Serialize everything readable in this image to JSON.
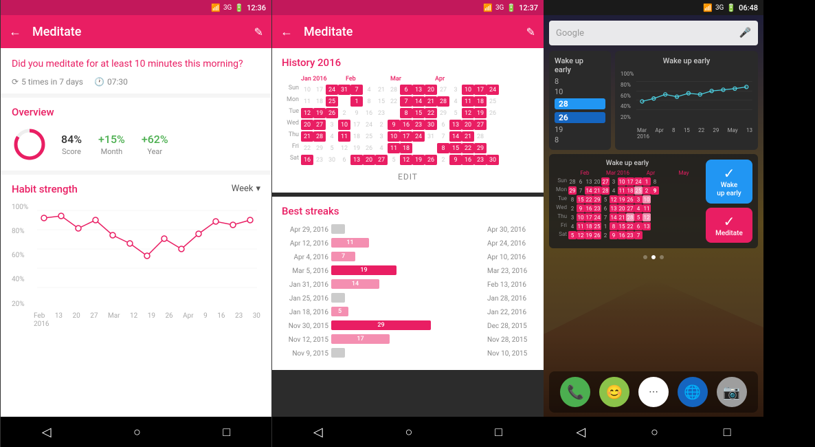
{
  "panel1": {
    "statusBar": {
      "time": "12:36",
      "icons": "📶 3G 🔋"
    },
    "appBar": {
      "title": "Meditate",
      "backLabel": "←",
      "editLabel": "✎"
    },
    "question": {
      "text": "Did you meditate for at least 10 minutes this morning?",
      "frequency": "5 times in 7 days",
      "time": "07:30"
    },
    "overview": {
      "title": "Overview",
      "score": "84%",
      "scoreLabel": "Score",
      "month": "+15%",
      "monthLabel": "Month",
      "year": "+62%",
      "yearLabel": "Year"
    },
    "habitStrength": {
      "title": "Habit strength",
      "selector": "Week",
      "yLabels": [
        "100%",
        "80%",
        "60%",
        "40%",
        "20%"
      ],
      "xLabels": [
        "Feb",
        "13",
        "20",
        "27",
        "Mar",
        "12",
        "19",
        "26",
        "Apr",
        "9",
        "16",
        "23",
        "30"
      ],
      "x2Labels": [
        "2016",
        "",
        "",
        "",
        "",
        "",
        "",
        "",
        "",
        "",
        "",
        "",
        ""
      ]
    }
  },
  "panel2": {
    "statusBar": {
      "time": "12:37"
    },
    "appBar": {
      "title": "Meditate"
    },
    "history": {
      "title": "History 2016",
      "editBtn": "EDIT"
    },
    "bestStreaks": {
      "title": "Best streaks",
      "streaks": [
        {
          "left": "Apr 29, 2016",
          "count": "",
          "right": "Apr 30, 2016",
          "size": "tiny"
        },
        {
          "left": "Apr 12, 2016",
          "count": "11",
          "right": "Apr 24, 2016",
          "size": "small"
        },
        {
          "left": "Apr 4, 2016",
          "count": "7",
          "right": "Apr 10, 2016",
          "size": "small"
        },
        {
          "left": "Mar 5, 2016",
          "count": "19",
          "right": "Mar 23, 2016",
          "size": "medium"
        },
        {
          "left": "Jan 31, 2016",
          "count": "14",
          "right": "Feb 13, 2016",
          "size": "medium-small"
        },
        {
          "left": "Jan 25, 2016",
          "count": "",
          "right": "Jan 28, 2016",
          "size": "tiny"
        },
        {
          "left": "Jan 18, 2016",
          "count": "5",
          "right": "Jan 22, 2016",
          "size": "tiny"
        },
        {
          "left": "Nov 30, 2015",
          "count": "29",
          "right": "Dec 28, 2015",
          "size": "large"
        },
        {
          "left": "Nov 12, 2015",
          "count": "17",
          "right": "Nov 28, 2015",
          "size": "medium"
        },
        {
          "left": "Nov 9, 2015",
          "count": "",
          "right": "Nov 10, 2015",
          "size": "tiny"
        }
      ]
    }
  },
  "panel3": {
    "statusBar": {
      "time": "06:48"
    },
    "searchBar": {
      "placeholder": "Google"
    },
    "wakeWidget": {
      "title": "Wake up early",
      "stats": [
        "8",
        "10",
        "28",
        "26",
        "19",
        "8"
      ]
    },
    "chartWidget": {
      "title": "Wake up early",
      "yLabels": [
        "100%",
        "80%",
        "60%",
        "40%",
        "20%"
      ],
      "xLabels": [
        "Mar",
        "Apr",
        "8",
        "15",
        "22",
        "29",
        "May",
        "13"
      ],
      "xLabels2": [
        "2016",
        "",
        "",
        "",
        "",
        "",
        "",
        ""
      ]
    },
    "calWidget": {
      "title": "Wake up early",
      "monthHeaders": [
        "Feb",
        "Mar 2016",
        "",
        "Apr",
        "",
        "May"
      ],
      "dayHeaders": [
        "Sun",
        "Mon",
        "Tue",
        "Wed",
        "Thu",
        "Fri",
        "Sat"
      ]
    },
    "appButtons": [
      {
        "label": "Wake\nup early",
        "color": "blue",
        "icon": "✓"
      },
      {
        "label": "Meditate",
        "color": "pink",
        "icon": "✓"
      }
    ],
    "dock": {
      "icons": [
        "📞",
        "💬",
        "⋯",
        "🌐",
        "📷"
      ]
    },
    "nav": [
      "◁",
      "○",
      "□"
    ]
  }
}
